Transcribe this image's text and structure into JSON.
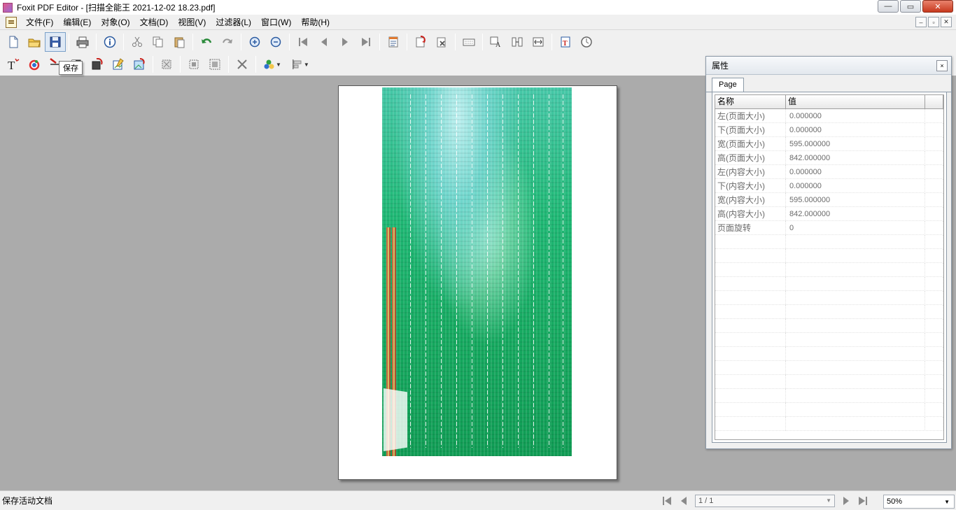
{
  "window": {
    "title": "Foxit PDF Editor - [扫描全能王 2021-12-02 18.23.pdf]",
    "minimize": "—",
    "restore": "▭",
    "close": "✕"
  },
  "menu": {
    "items": [
      {
        "label": "文件(F)"
      },
      {
        "label": "编辑(E)"
      },
      {
        "label": "对象(O)"
      },
      {
        "label": "文档(D)"
      },
      {
        "label": "视图(V)"
      },
      {
        "label": "过滤器(L)"
      },
      {
        "label": "窗口(W)"
      },
      {
        "label": "帮助(H)"
      }
    ],
    "mdi_minimize": "–",
    "mdi_restore": "▫",
    "mdi_close": "✕"
  },
  "tooltip": {
    "text": "保存"
  },
  "properties": {
    "title": "属性",
    "close": "×",
    "tab": "Page",
    "columns": [
      "名称",
      "值"
    ],
    "rows": [
      {
        "name": "左(页面大小)",
        "value": "0.000000"
      },
      {
        "name": "下(页面大小)",
        "value": "0.000000"
      },
      {
        "name": "宽(页面大小)",
        "value": "595.000000"
      },
      {
        "name": "高(页面大小)",
        "value": "842.000000"
      },
      {
        "name": "左(内容大小)",
        "value": "0.000000"
      },
      {
        "name": "下(内容大小)",
        "value": "0.000000"
      },
      {
        "name": "宽(内容大小)",
        "value": "595.000000"
      },
      {
        "name": "高(内容大小)",
        "value": "842.000000"
      },
      {
        "name": "页面旋转",
        "value": "0"
      }
    ]
  },
  "status": {
    "text": "保存活动文档",
    "page_indicator": "1 / 1",
    "zoom": "50%"
  },
  "colors": {
    "accent": "#7aa0c8",
    "close_button": "#c7391e",
    "workspace": "#ababab",
    "scan_green": "#14a85e"
  }
}
